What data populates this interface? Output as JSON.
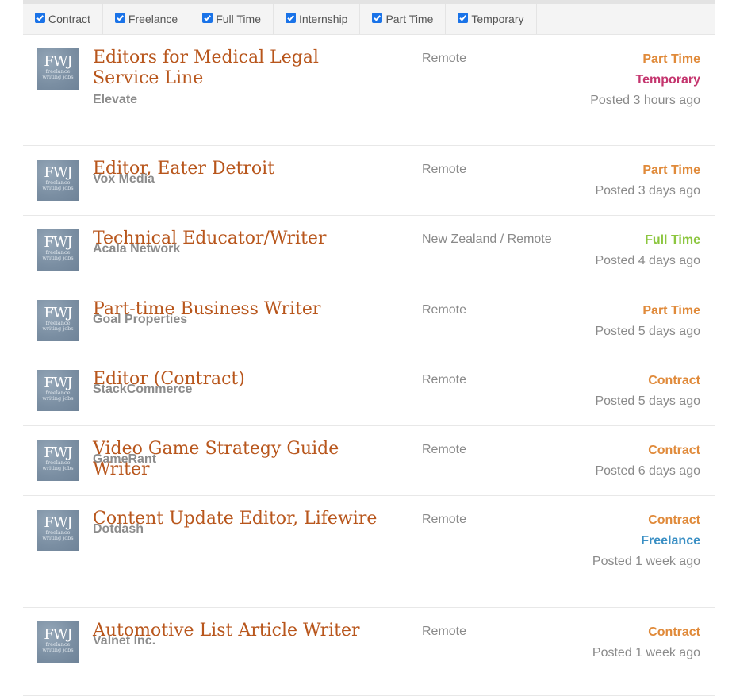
{
  "filters": [
    {
      "label": "Contract",
      "checked": true
    },
    {
      "label": "Freelance",
      "checked": true
    },
    {
      "label": "Full Time",
      "checked": true
    },
    {
      "label": "Internship",
      "checked": true
    },
    {
      "label": "Part Time",
      "checked": true
    },
    {
      "label": "Temporary",
      "checked": true
    }
  ],
  "logo": {
    "big": "FWJ",
    "line1": "freelance",
    "line2": "writing jobs"
  },
  "type_colors": {
    "Part Time": "#e08a3a",
    "Temporary": "#c4356e",
    "Full Time": "#8cc63f",
    "Contract": "#e08a3a",
    "Freelance": "#3a8fc4"
  },
  "jobs": [
    {
      "title": "Editors for Medical Legal Service Line",
      "company": "Elevate",
      "location": "Remote",
      "types": [
        "Part Time",
        "Temporary"
      ],
      "posted": "Posted 3 hours ago"
    },
    {
      "title": "Editor, Eater Detroit",
      "company": "Vox Media",
      "location": "Remote",
      "types": [
        "Part Time"
      ],
      "posted": "Posted 3 days ago"
    },
    {
      "title": "Technical Educator/Writer",
      "company": "Acala Network",
      "location": "New Zealand / Remote",
      "types": [
        "Full Time"
      ],
      "posted": "Posted 4 days ago"
    },
    {
      "title": "Part-time Business Writer",
      "company": "Goal Properties",
      "location": "Remote",
      "types": [
        "Part Time"
      ],
      "posted": "Posted 5 days ago"
    },
    {
      "title": "Editor (Contract)",
      "company": "StackCommerce",
      "location": "Remote",
      "types": [
        "Contract"
      ],
      "posted": "Posted 5 days ago"
    },
    {
      "title": "Video Game Strategy Guide Writer",
      "company": "GameRant",
      "location": "Remote",
      "types": [
        "Contract"
      ],
      "posted": "Posted 6 days ago"
    },
    {
      "title": "Content Update Editor, Lifewire",
      "company": "Dotdash",
      "location": "Remote",
      "types": [
        "Contract",
        "Freelance"
      ],
      "posted": "Posted 1 week ago"
    },
    {
      "title": "Automotive List Article Writer",
      "company": "Valnet Inc.",
      "location": "Remote",
      "types": [
        "Contract"
      ],
      "posted": "Posted 1 week ago"
    }
  ]
}
